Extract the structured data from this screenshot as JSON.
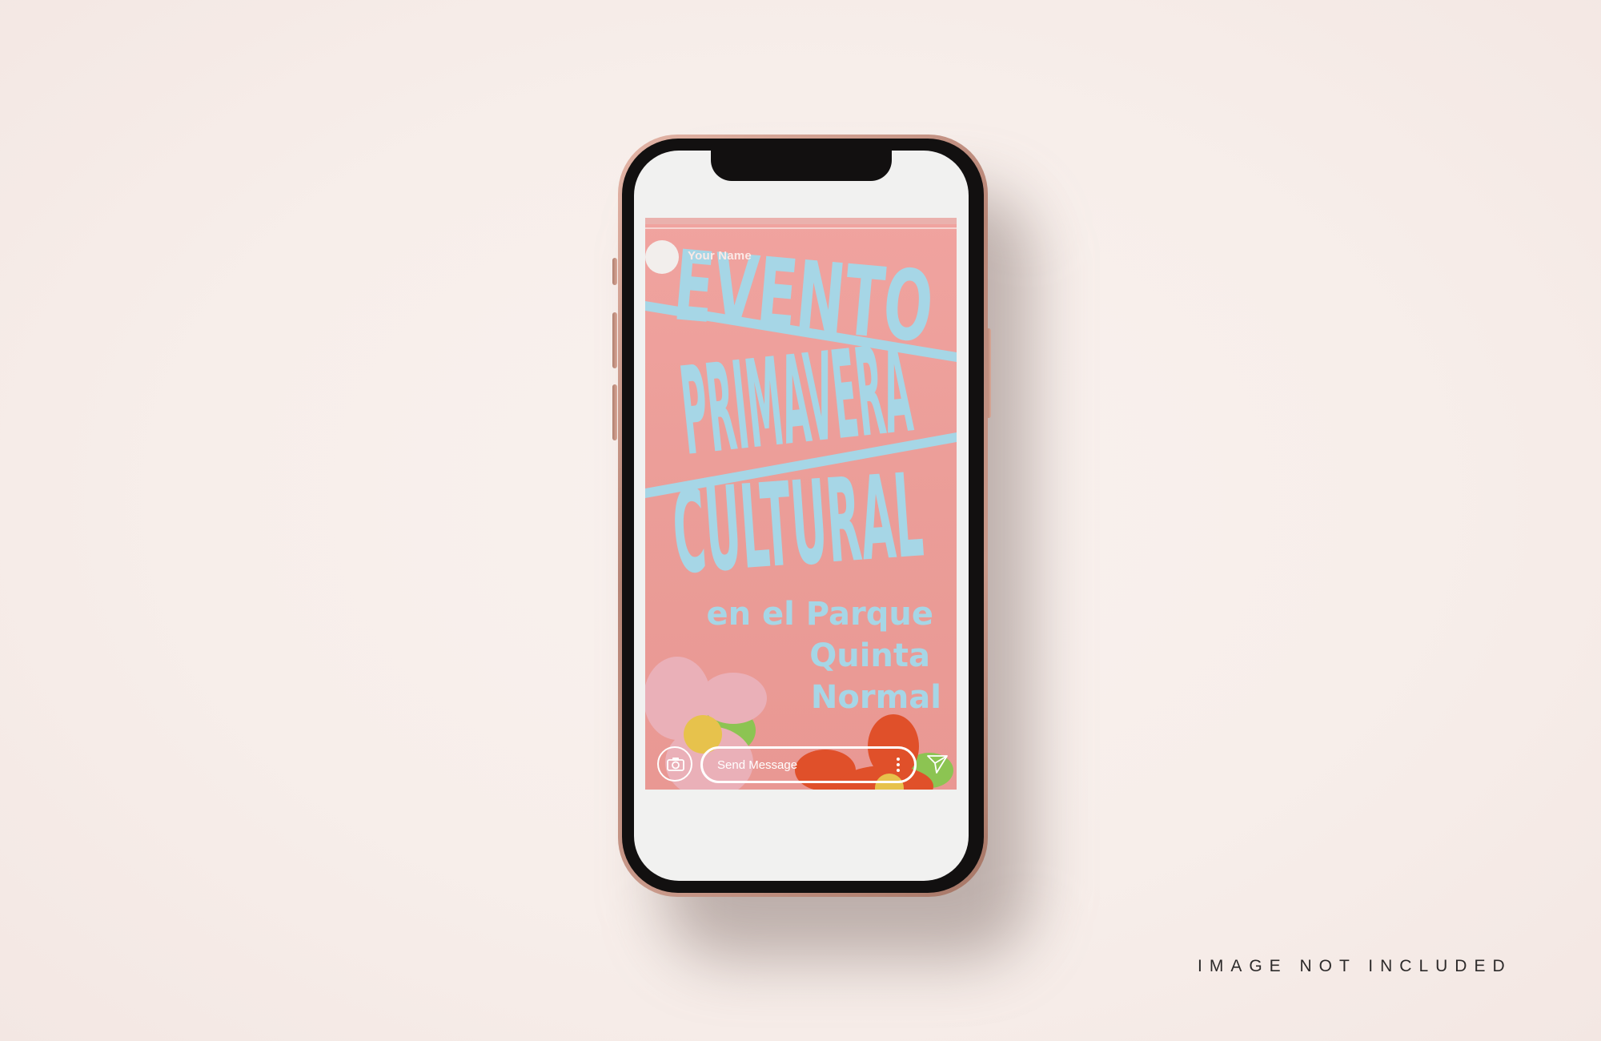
{
  "story": {
    "user_name": "Your Name",
    "progress": 1.0,
    "poster": {
      "line1": "EVENTO",
      "line2": "PRIMAVERA",
      "line3": "CULTURAL",
      "line4": "en el Parque",
      "line5": "Quinta",
      "line6": "Normal"
    },
    "message_placeholder": "Send Message"
  },
  "icons": {
    "camera": "camera-icon",
    "more": "more-vertical-icon",
    "send": "send-icon"
  },
  "colors": {
    "background": "#f7efec",
    "poster_bg": "#eb9d98",
    "poster_text": "#a6d6e6",
    "phone_frame": "#c9998a"
  },
  "watermark": "IMAGE NOT INCLUDED"
}
